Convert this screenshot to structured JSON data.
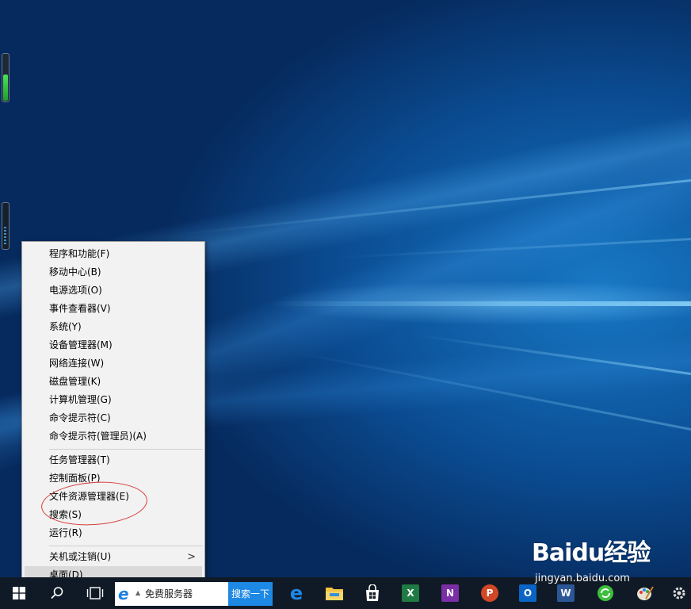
{
  "context_menu": {
    "items_group1": [
      {
        "label": "程序和功能(F)"
      },
      {
        "label": "移动中心(B)"
      },
      {
        "label": "电源选项(O)"
      },
      {
        "label": "事件查看器(V)"
      },
      {
        "label": "系统(Y)"
      },
      {
        "label": "设备管理器(M)"
      },
      {
        "label": "网络连接(W)"
      },
      {
        "label": "磁盘管理(K)"
      },
      {
        "label": "计算机管理(G)"
      },
      {
        "label": "命令提示符(C)"
      },
      {
        "label": "命令提示符(管理员)(A)"
      }
    ],
    "items_group2": [
      {
        "label": "任务管理器(T)"
      },
      {
        "label": "控制面板(P)"
      },
      {
        "label": "文件资源管理器(E)"
      },
      {
        "label": "搜索(S)"
      },
      {
        "label": "运行(R)"
      }
    ],
    "items_group3": [
      {
        "label": "关机或注销(U)",
        "has_submenu": true,
        "arrow": ">"
      },
      {
        "label": "桌面(D)",
        "highlighted": true
      }
    ]
  },
  "taskbar": {
    "search_text": "免费服务器",
    "search_button": "搜索一下",
    "icons": [
      "windows-start-icon",
      "search-icon",
      "task-view-icon",
      "ie-icon",
      "edge-icon",
      "file-explorer-icon",
      "store-icon",
      "excel-icon",
      "onenote-icon",
      "powerpoint-icon",
      "outlook-icon",
      "word-icon",
      "green-refresh-icon",
      "paint-icon",
      "settings-icon"
    ],
    "accent": "#1e88e5"
  },
  "desktop_gadget": {
    "level": 0.55,
    "color": "#2fbf3e"
  },
  "watermark": {
    "logo": "Baidu经验",
    "url": "jingyan.baidu.com"
  }
}
